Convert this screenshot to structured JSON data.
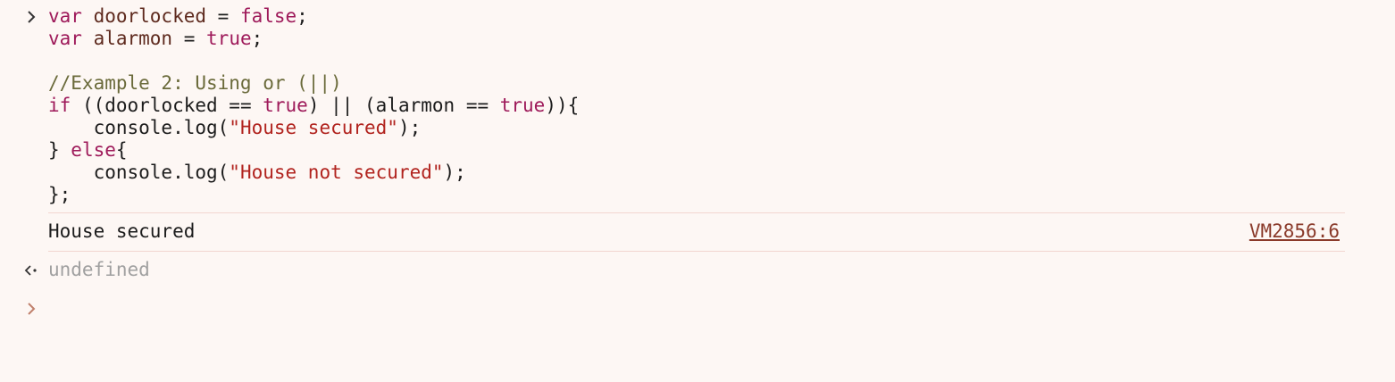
{
  "input": {
    "lines": [
      [
        {
          "t": "var ",
          "c": "kw"
        },
        {
          "t": "doorlocked",
          "c": "ident"
        },
        {
          "t": " = ",
          "c": "plain"
        },
        {
          "t": "false",
          "c": "kw"
        },
        {
          "t": ";",
          "c": "plain"
        }
      ],
      [
        {
          "t": "var ",
          "c": "kw"
        },
        {
          "t": "alarmon",
          "c": "ident"
        },
        {
          "t": " = ",
          "c": "plain"
        },
        {
          "t": "true",
          "c": "kw"
        },
        {
          "t": ";",
          "c": "plain"
        }
      ],
      [],
      [
        {
          "t": "//Example 2: Using or (||)",
          "c": "comment"
        }
      ],
      [
        {
          "t": "if",
          "c": "kw"
        },
        {
          "t": " ((doorlocked == ",
          "c": "plain"
        },
        {
          "t": "true",
          "c": "kw"
        },
        {
          "t": ") || (alarmon == ",
          "c": "plain"
        },
        {
          "t": "true",
          "c": "kw"
        },
        {
          "t": ")){",
          "c": "plain"
        }
      ],
      [
        {
          "t": "    console.log(",
          "c": "plain"
        },
        {
          "t": "\"House secured\"",
          "c": "str"
        },
        {
          "t": ");",
          "c": "plain"
        }
      ],
      [
        {
          "t": "} ",
          "c": "plain"
        },
        {
          "t": "else",
          "c": "kw"
        },
        {
          "t": "{",
          "c": "plain"
        }
      ],
      [
        {
          "t": "    console.log(",
          "c": "plain"
        },
        {
          "t": "\"House not secured\"",
          "c": "str"
        },
        {
          "t": ");",
          "c": "plain"
        }
      ],
      [
        {
          "t": "};",
          "c": "plain"
        }
      ]
    ]
  },
  "log": {
    "message": "House secured",
    "source": "VM2856:6"
  },
  "result": {
    "value": "undefined"
  },
  "colors": {
    "background": "#fdf7f4",
    "keyword": "#9e1a5a",
    "string": "#b1231e",
    "comment": "#6a6a3a",
    "prompt": "#c0806c",
    "divider": "#f2d6d0"
  },
  "icons": {
    "input_prompt": "chevron-right-icon",
    "result_prompt": "return-arrow-icon",
    "new_prompt": "chevron-right-icon"
  }
}
